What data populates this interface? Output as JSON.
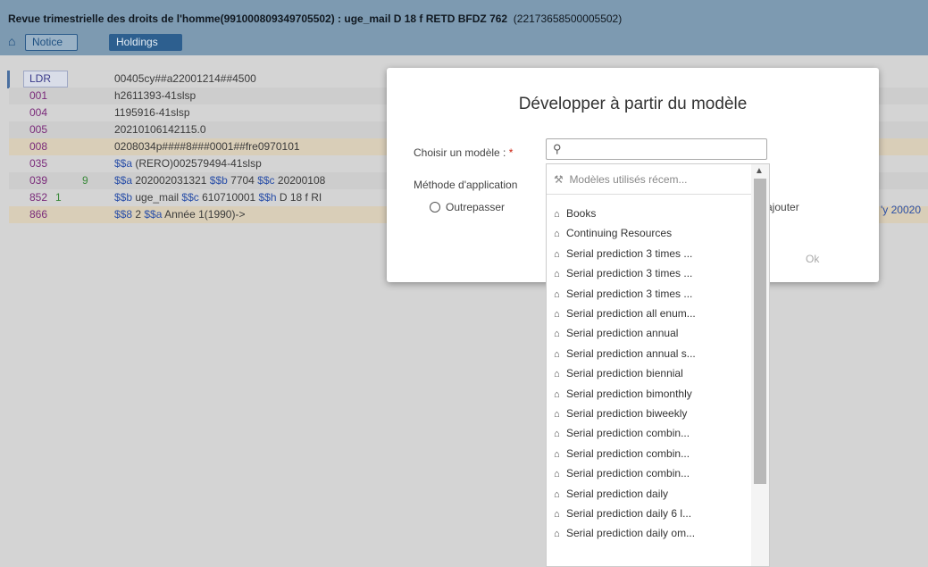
{
  "header": {
    "title_bold": "Revue trimestrielle des droits de l'homme(991000809349705502) : uge_mail D 18 f RETD BFDZ 762",
    "title_id": "(22173658500005502)",
    "tabs": [
      {
        "label": "Notice"
      },
      {
        "label": "Holdings"
      }
    ]
  },
  "records": [
    {
      "tag": "LDR",
      "ind": "",
      "value": "00405cy##a22001214##4500"
    },
    {
      "tag": "001",
      "ind": "",
      "value": "h2611393-41slsp"
    },
    {
      "tag": "004",
      "ind": "",
      "value": "1195916-41slsp"
    },
    {
      "tag": "005",
      "ind": "",
      "value": "20210106142115.0"
    },
    {
      "tag": "008",
      "ind": "",
      "value": "0208034p####8###0001##fre0970101"
    },
    {
      "tag": "035",
      "ind": "",
      "sub1": "$$a",
      "value": " (RERO)002579494-41slsp"
    },
    {
      "tag": "039",
      "ind": "9",
      "sub1": "$$a",
      "value": " 202002031321 ",
      "sub2": "$$b",
      "value2": " 7704 ",
      "sub3": "$$c",
      "value3": " 20200108"
    },
    {
      "tag": "852",
      "ind": "1",
      "sub1": "$$b",
      "value": " uge_mail ",
      "sub2": "$$c",
      "value2": " 610710001 ",
      "sub3": "$$h",
      "value3": " D 18 f RI"
    },
    {
      "tag": "866",
      "ind": "",
      "sub1": "$$8",
      "value": " 2 ",
      "sub2": "$$a",
      "value2": " Année 1(1990)->"
    }
  ],
  "behind_right_text": "'y 20020",
  "modal": {
    "title": "Développer à partir du modèle",
    "choose_label": "Choisir un modèle : ",
    "required_mark": "*",
    "search_placeholder": "",
    "method_label": "Méthode d'application",
    "override_label": "Outrepasser",
    "add_label": "ajouter",
    "ok_label": "Ok"
  },
  "dropdown": {
    "recent_header": "Modèles utilisés récem...",
    "items": [
      "Books",
      "Continuing Resources",
      "Serial prediction 3 times ...",
      "Serial prediction 3 times ...",
      "Serial prediction 3 times ...",
      "Serial prediction all enum...",
      "Serial prediction annual",
      "Serial prediction annual s...",
      "Serial prediction biennial",
      "Serial prediction bimonthly",
      "Serial prediction biweekly",
      "Serial prediction combin...",
      "Serial prediction combin...",
      "Serial prediction combin...",
      "Serial prediction daily",
      "Serial prediction daily 6 l...",
      "Serial prediction daily om..."
    ]
  }
}
